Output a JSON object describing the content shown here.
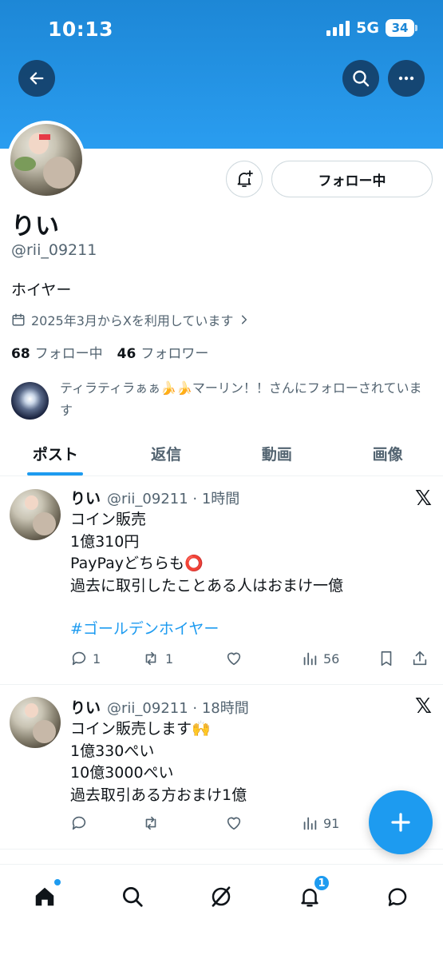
{
  "status": {
    "time": "10:13",
    "network": "5G",
    "battery": "34"
  },
  "profile": {
    "name": "りい",
    "handle": "@rii_09211",
    "bio": "ホイヤー",
    "joined": "2025年3月からXを利用しています",
    "following_count": "68",
    "following_label": "フォロー中",
    "followers_count": "46",
    "followers_label": "フォロワー",
    "follow_button": "フォロー中",
    "followed_by": "ティラティラぁぁ🍌🍌マーリン！！さんにフォローされています"
  },
  "tabs": [
    {
      "label": "ポスト",
      "active": true
    },
    {
      "label": "返信",
      "active": false
    },
    {
      "label": "動画",
      "active": false
    },
    {
      "label": "画像",
      "active": false
    }
  ],
  "posts": [
    {
      "name": "りい",
      "meta": "@rii_09211 · 1時間",
      "lines": [
        "コイン販売",
        "1億310円",
        "PayPayどちらも⭕",
        "過去に取引したことある人はおまけ一億"
      ],
      "hashtag": "#ゴールデンホイヤー",
      "replies": "1",
      "reposts": "1",
      "likes": "",
      "views": "56"
    },
    {
      "name": "りい",
      "meta": "@rii_09211 · 18時間",
      "lines": [
        "コイン販売します🙌",
        "1億330ぺい",
        "10億3000ぺい",
        "過去取引ある方おまけ1億"
      ],
      "replies": "",
      "reposts": "",
      "likes": "",
      "views": "91"
    }
  ],
  "notifications_badge": "1",
  "colors": {
    "accent": "#1d9bf0",
    "banner": "#2a9df0",
    "text": "#0f1419",
    "muted": "#536471"
  }
}
